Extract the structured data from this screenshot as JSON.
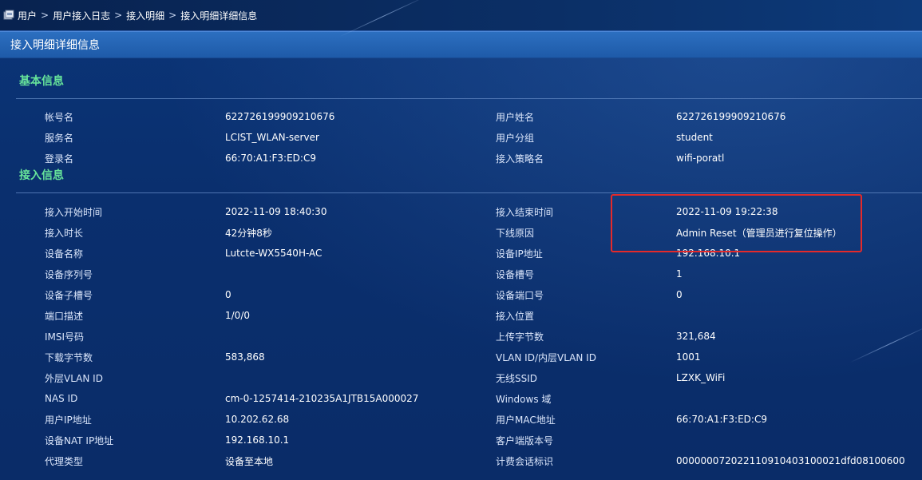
{
  "breadcrumb": [
    "用户",
    "用户接入日志",
    "接入明细",
    "接入明细详细信息"
  ],
  "panel_title": "接入明细详细信息",
  "basic_info": {
    "title": "基本信息",
    "rows": [
      {
        "l1": "帐号名",
        "v1": "622726199909210676",
        "l2": "用户姓名",
        "v2": "622726199909210676"
      },
      {
        "l1": "服务名",
        "v1": "LCIST_WLAN-server",
        "l2": "用户分组",
        "v2": "student"
      },
      {
        "l1": "登录名",
        "v1": "66:70:A1:F3:ED:C9",
        "l2": "接入策略名",
        "v2": "wifi-poratl"
      }
    ]
  },
  "access_info": {
    "title": "接入信息",
    "rows": [
      {
        "l1": "接入开始时间",
        "v1": "2022-11-09 18:40:30",
        "l2": "接入结束时间",
        "v2": "2022-11-09 19:22:38"
      },
      {
        "l1": "接入时长",
        "v1": "42分钟8秒",
        "l2": "下线原因",
        "v2": "Admin Reset（管理员进行复位操作）"
      },
      {
        "l1": "设备名称",
        "v1": "Lutcte-WX5540H-AC",
        "l2": "设备IP地址",
        "v2": "192.168.10.1"
      },
      {
        "l1": "设备序列号",
        "v1": "",
        "l2": "设备槽号",
        "v2": "1"
      },
      {
        "l1": "设备子槽号",
        "v1": "0",
        "l2": "设备端口号",
        "v2": "0"
      },
      {
        "l1": "端口描述",
        "v1": "1/0/0",
        "l2": "接入位置",
        "v2": ""
      },
      {
        "l1": "IMSI号码",
        "v1": "",
        "l2": "上传字节数",
        "v2": "321,684"
      },
      {
        "l1": "下载字节数",
        "v1": "583,868",
        "l2": "VLAN ID/内层VLAN ID",
        "v2": "1001"
      },
      {
        "l1": "外层VLAN ID",
        "v1": "",
        "l2": "无线SSID",
        "v2": "LZXK_WiFi"
      },
      {
        "l1": "NAS ID",
        "v1": "cm-0-1257414-210235A1JTB15A000027",
        "l2": "Windows 域",
        "v2": ""
      },
      {
        "l1": "用户IP地址",
        "v1": "10.202.62.68",
        "l2": "用户MAC地址",
        "v2": "66:70:A1:F3:ED:C9"
      },
      {
        "l1": "设备NAT IP地址",
        "v1": "192.168.10.1",
        "l2": "客户端版本号",
        "v2": ""
      },
      {
        "l1": "代理类型",
        "v1": "设备至本地",
        "l2": "计费会话标识",
        "v2": "000000072022110910403100021dfd08100600"
      }
    ]
  },
  "colors": {
    "section_title": "#66e39a",
    "highlight_border": "#e52a2a",
    "panel_title_bg": "#2c6fc0"
  }
}
